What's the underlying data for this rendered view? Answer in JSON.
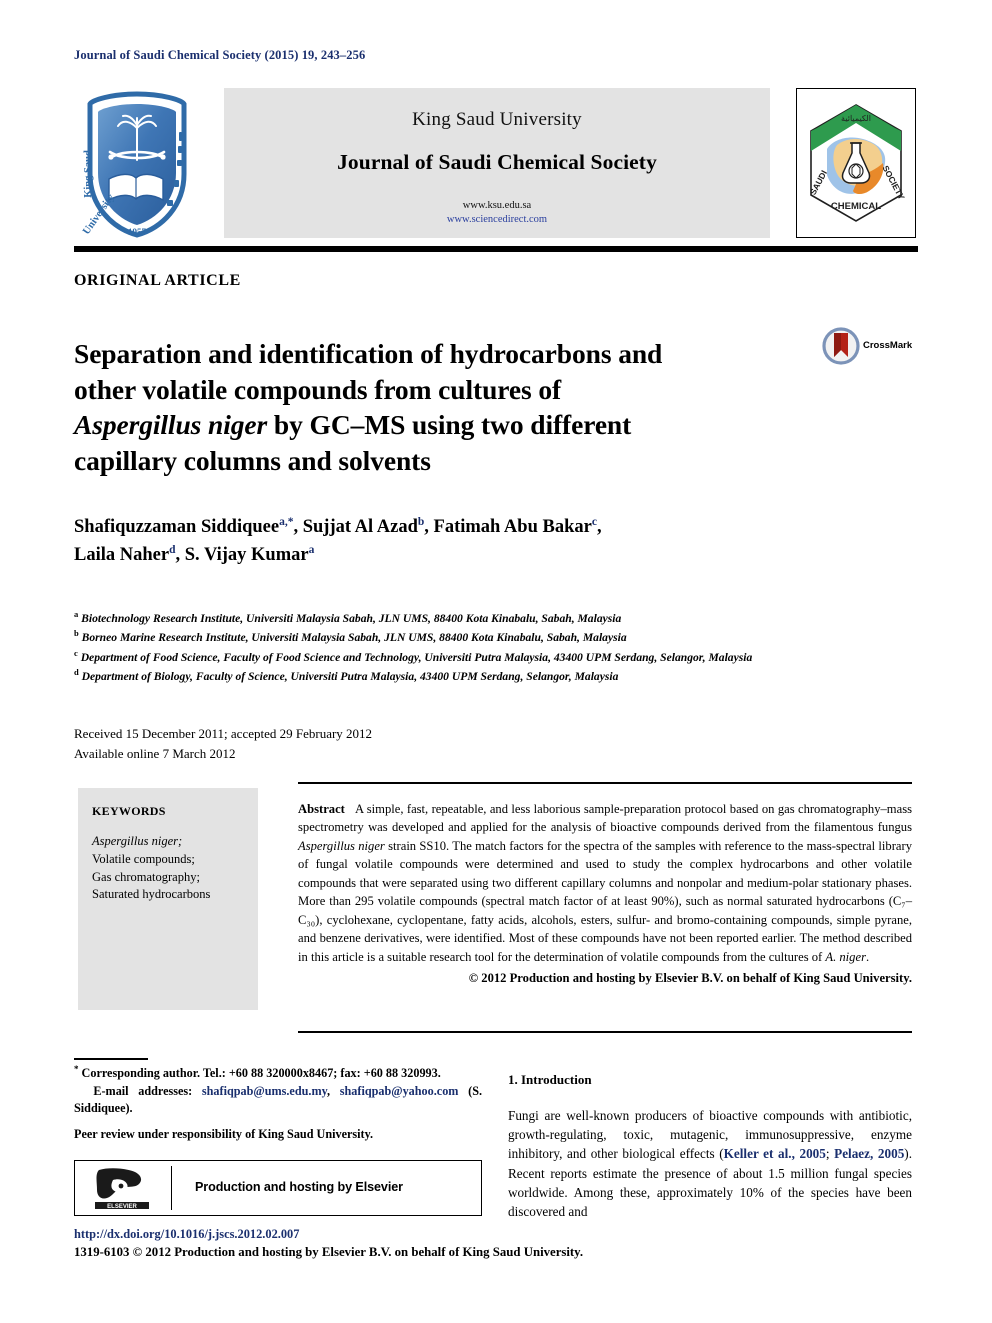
{
  "running_head": "Journal of Saudi Chemical Society (2015) 19, 243–256",
  "masthead": {
    "university": "King Saud University",
    "journal_title": "Journal of Saudi Chemical Society",
    "url_primary": "www.ksu.edu.sa",
    "url_secondary": "www.sciencedirect.com",
    "ksu_logo_name": "King Saud University",
    "ksu_logo_year": "1957",
    "scs_logo_text_left": "SAUDI",
    "scs_logo_text_right": "SOCIETY",
    "scs_logo_text_bottom": "CHEMICAL"
  },
  "article_type": "ORIGINAL ARTICLE",
  "title": {
    "line1": "Separation and identification of hydrocarbons and",
    "line2": "other volatile compounds from cultures of",
    "line3_italic": "Aspergillus niger",
    "line3_rest": " by GC–MS using two different",
    "line4": "capillary columns and solvents"
  },
  "crossmark": {
    "label": "CrossMark"
  },
  "authors": [
    {
      "name": "Shafiquzzaman Siddiquee",
      "marks": "a,*",
      "sep": ", "
    },
    {
      "name": "Sujjat Al Azad",
      "marks": "b",
      "sep": ", "
    },
    {
      "name": "Fatimah Abu Bakar",
      "marks": "c",
      "sep": ", "
    },
    {
      "name": "Laila Naher",
      "marks": "d",
      "sep": ", "
    },
    {
      "name": "S. Vijay Kumar",
      "marks": "a",
      "sep": ""
    }
  ],
  "affiliations": [
    {
      "mark": "a",
      "text": "Biotechnology Research Institute, Universiti Malaysia Sabah, JLN UMS, 88400 Kota Kinabalu, Sabah, Malaysia"
    },
    {
      "mark": "b",
      "text": "Borneo Marine Research Institute, Universiti Malaysia Sabah, JLN UMS, 88400 Kota Kinabalu, Sabah, Malaysia"
    },
    {
      "mark": "c",
      "text": "Department of Food Science, Faculty of Food Science and Technology, Universiti Putra Malaysia, 43400 UPM Serdang, Selangor, Malaysia"
    },
    {
      "mark": "d",
      "text": "Department of Biology, Faculty of Science, Universiti Putra Malaysia, 43400 UPM Serdang, Selangor, Malaysia"
    }
  ],
  "dates": {
    "received": "Received 15 December 2011; accepted 29 February 2012",
    "available": "Available online 7 March 2012"
  },
  "keywords": {
    "heading": "KEYWORDS",
    "items": [
      "Aspergillus niger;",
      "Volatile compounds;",
      "Gas chromatography;",
      "Saturated hydrocarbons"
    ]
  },
  "abstract": {
    "heading": "Abstract",
    "part1": "A simple, fast, repeatable, and less laborious sample-preparation protocol based on gas chromatography–mass spectrometry was developed and applied for the analysis of bioactive compounds derived from the filamentous fungus ",
    "species1": "Aspergillus niger",
    "part2": " strain SS10. The match factors for the spectra of the samples with reference to the mass-spectral library of fungal volatile compounds were determined and used to study the complex hydrocarbons and other volatile compounds that were separated using two different capillary columns and nonpolar and medium-polar stationary phases. More than 295 volatile compounds (spectral match factor of at least 90%), such as normal saturated hydrocarbons (C₇–C₃₀), cyclohexane, cyclopentane, fatty acids, alcohols, esters, sulfur- and bromo-containing compounds, simple pyrane, and benzene derivatives, were identified. Most of these compounds have not been reported earlier. The method described in this article is a suitable research tool for the determination of volatile compounds from the cultures of ",
    "species2": "A. niger",
    "part3": ".",
    "copyright": "© 2012 Production and hosting by Elsevier B.V. on behalf of King Saud University."
  },
  "footnotes": {
    "corresponding": "Corresponding author. Tel.: +60 88 320000x8467; fax: +60 88 320993.",
    "email_label": "E-mail addresses:",
    "email1": "shafiqpab@ums.edu.my",
    "email2": "shafiqpab@yahoo.com",
    "email_suffix": "(S. Siddiquee).",
    "peer_review": "Peer review under responsibility of King Saud University."
  },
  "elsevier": {
    "logo_word": "ELSEVIER",
    "text": "Production and hosting by Elsevier"
  },
  "doi": "http://dx.doi.org/10.1016/j.jscs.2012.02.007",
  "issn_line": "1319-6103 © 2012 Production and hosting by Elsevier B.V. on behalf of King Saud University.",
  "introduction": {
    "heading": "1. Introduction",
    "p1a": "Fungi are well-known producers of bioactive compounds with antibiotic, growth-regulating, toxic, mutagenic, immunosuppressive, enzyme inhibitory, and other biological effects (",
    "cite1": "Keller et al., 2005",
    "p1b": "; ",
    "cite2": "Pelaez, 2005",
    "p1c": "). Recent reports estimate the presence of about 1.5 million fungal species worldwide. Among these, approximately 10% of the species have been discovered and"
  },
  "colors": {
    "link_blue": "#1a2f6e",
    "panel_gray": "#e3e3e3",
    "rule_black": "#000000"
  }
}
